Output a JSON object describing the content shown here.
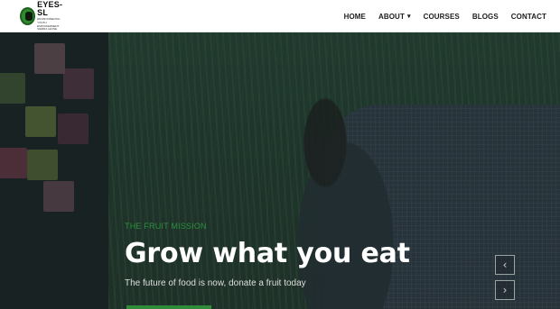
{
  "brand": {
    "name": "EYES-SL",
    "tagline": "ENVIRONMENTAL YOUTH EMPOWERMENT SIERRA LEONE",
    "colors": {
      "primary_green": "#2e8b3a",
      "eyebrow_green": "#2f8f3f",
      "nav_text": "#1c1c1c"
    }
  },
  "nav": {
    "items": [
      {
        "label": "HOME"
      },
      {
        "label": "ABOUT",
        "icon": "chevron-down-icon"
      },
      {
        "label": "COURSES"
      },
      {
        "label": "BLOGS"
      },
      {
        "label": "CONTACT"
      }
    ]
  },
  "hero": {
    "eyebrow": "THE FRUIT MISSION",
    "headline": "Grow what you eat",
    "subline": "The future of food is now, donate a fruit today",
    "prev_icon": "chevron-left-icon",
    "next_icon": "chevron-right-icon",
    "prev_glyph": "‹",
    "next_glyph": "›"
  }
}
